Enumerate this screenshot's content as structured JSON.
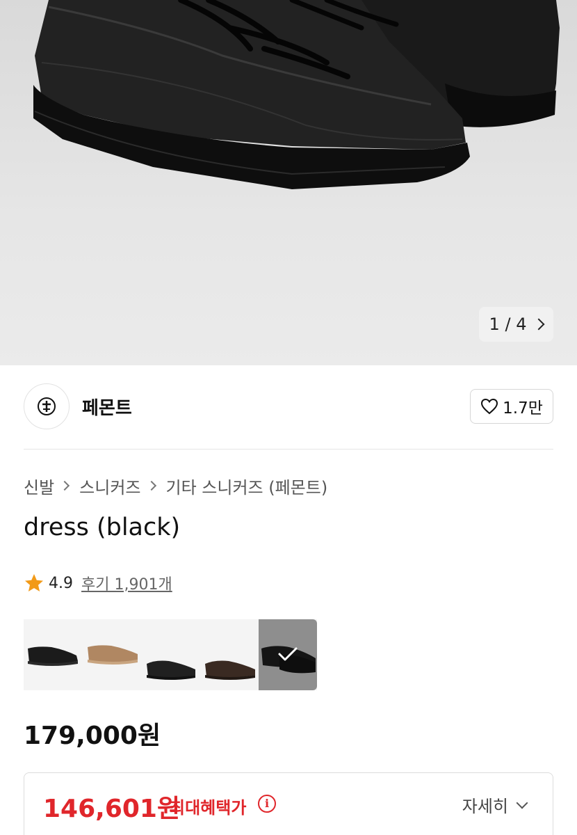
{
  "gallery": {
    "current": "1",
    "total": "4",
    "separator": "/"
  },
  "brand": {
    "name": "페몬트",
    "like_count": "1.7만"
  },
  "breadcrumb": [
    "신발",
    "스니커즈",
    "기타 스니커즈 (페몬트)"
  ],
  "product": {
    "title": "dress (black)",
    "rating": "4.9",
    "reviews": "후기 1,901개",
    "price": "179,000원"
  },
  "color_options": [
    {
      "name": "black-suede",
      "color": "#1b1b1b"
    },
    {
      "name": "tan-suede",
      "color": "#b08762"
    },
    {
      "name": "black-leather-low",
      "color": "#202020"
    },
    {
      "name": "brown-suede",
      "color": "#3a2a22"
    },
    {
      "name": "black-leather",
      "color": "#111111",
      "selected": true
    }
  ],
  "benefit": {
    "price": "146,601원",
    "label": "최대혜택가",
    "info_icon": "i",
    "detail": "자세히"
  },
  "colors": {
    "accent_red": "#e0262b",
    "star": "#f29a18"
  }
}
